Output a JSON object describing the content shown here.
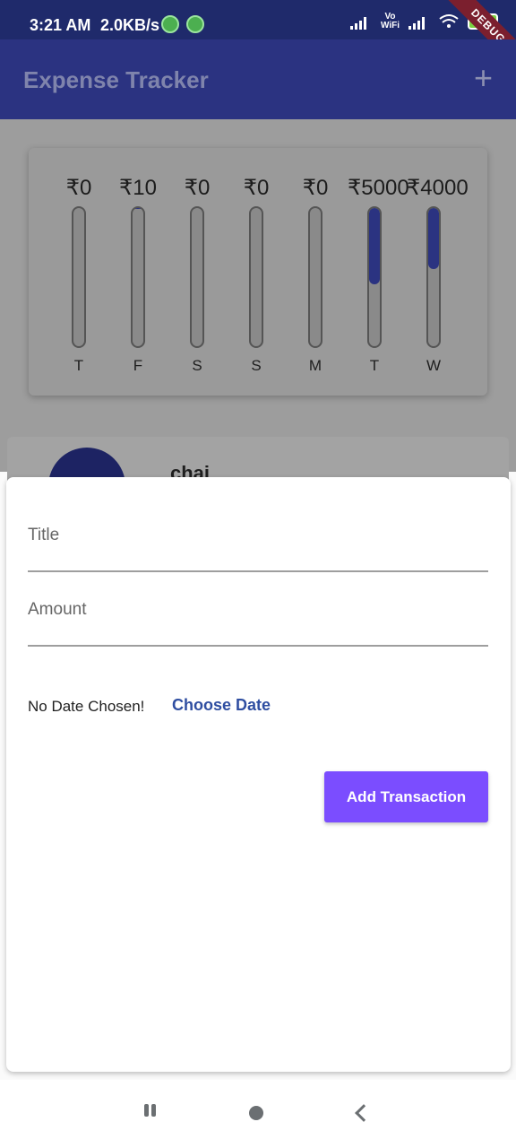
{
  "status_bar": {
    "time": "3:21 AM",
    "network_speed": "2.0KB/s",
    "battery": "77",
    "debug_banner": "DEBUG"
  },
  "app_bar": {
    "title": "Expense Tracker",
    "add_icon": "+"
  },
  "chart_data": {
    "type": "bar",
    "categories": [
      "T",
      "F",
      "S",
      "S",
      "M",
      "T",
      "W"
    ],
    "values": [
      0,
      10,
      0,
      0,
      0,
      5000,
      4000
    ],
    "labels": [
      "₹0",
      "₹10",
      "₹0",
      "₹0",
      "₹0",
      "₹5000",
      "₹4000"
    ],
    "fill_fractions": [
      0,
      0.001,
      0,
      0,
      0,
      0.555,
      0.444
    ],
    "ylim": [
      0,
      9010
    ]
  },
  "transaction": {
    "title": "chai"
  },
  "new_transaction_form": {
    "title_label": "Title",
    "amount_label": "Amount",
    "date_status": "No Date Chosen!",
    "choose_date_label": "Choose Date",
    "submit_label": "Add Transaction"
  },
  "colors": {
    "primary": "#2b3381",
    "accent": "#7b4dff",
    "date_button": "#2f4ea1"
  }
}
